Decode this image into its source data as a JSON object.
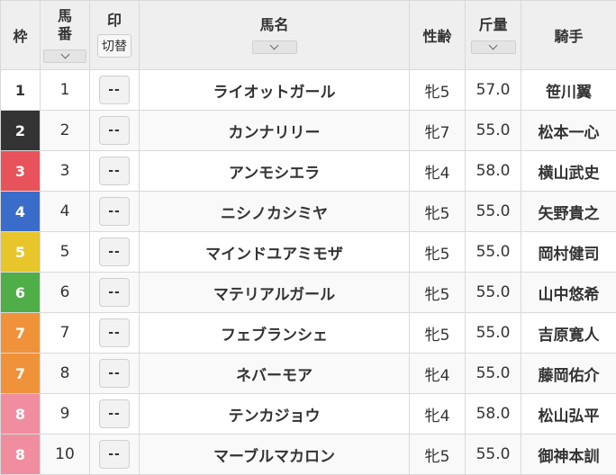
{
  "headers": {
    "waku": "枠",
    "umaban_top": "馬",
    "umaban_bottom": "番",
    "mark": "印",
    "mark_switch": "切替",
    "horse": "馬名",
    "sexage": "性齢",
    "weight": "斤量",
    "jockey": "騎手"
  },
  "frame_colors": {
    "1": {
      "bg": "#ffffff",
      "fg": "#333333"
    },
    "2": {
      "bg": "#333333",
      "fg": "#ffffff"
    },
    "3": {
      "bg": "#e8525a",
      "fg": "#ffffff"
    },
    "4": {
      "bg": "#3a6cc9",
      "fg": "#ffffff"
    },
    "5": {
      "bg": "#e8c52a",
      "fg": "#ffffff"
    },
    "6": {
      "bg": "#4fae48",
      "fg": "#ffffff"
    },
    "7": {
      "bg": "#f0923a",
      "fg": "#ffffff"
    },
    "8": {
      "bg": "#f08ea0",
      "fg": "#ffffff"
    }
  },
  "rows": [
    {
      "waku": "1",
      "umaban": "1",
      "mark": "--",
      "horse": "ライオットガール",
      "sexage": "牝5",
      "weight": "57.0",
      "jockey": "笹川翼"
    },
    {
      "waku": "2",
      "umaban": "2",
      "mark": "--",
      "horse": "カンナリリー",
      "sexage": "牝7",
      "weight": "55.0",
      "jockey": "松本一心"
    },
    {
      "waku": "3",
      "umaban": "3",
      "mark": "--",
      "horse": "アンモシエラ",
      "sexage": "牝4",
      "weight": "58.0",
      "jockey": "横山武史"
    },
    {
      "waku": "4",
      "umaban": "4",
      "mark": "--",
      "horse": "ニシノカシミヤ",
      "sexage": "牝5",
      "weight": "55.0",
      "jockey": "矢野貴之"
    },
    {
      "waku": "5",
      "umaban": "5",
      "mark": "--",
      "horse": "マインドユアミモザ",
      "sexage": "牝5",
      "weight": "55.0",
      "jockey": "岡村健司"
    },
    {
      "waku": "6",
      "umaban": "6",
      "mark": "--",
      "horse": "マテリアルガール",
      "sexage": "牝5",
      "weight": "55.0",
      "jockey": "山中悠希"
    },
    {
      "waku": "7",
      "umaban": "7",
      "mark": "--",
      "horse": "フェブランシェ",
      "sexage": "牝5",
      "weight": "55.0",
      "jockey": "吉原寛人"
    },
    {
      "waku": "7",
      "umaban": "8",
      "mark": "--",
      "horse": "ネバーモア",
      "sexage": "牝4",
      "weight": "55.0",
      "jockey": "藤岡佑介"
    },
    {
      "waku": "8",
      "umaban": "9",
      "mark": "--",
      "horse": "テンカジョウ",
      "sexage": "牝4",
      "weight": "58.0",
      "jockey": "松山弘平"
    },
    {
      "waku": "8",
      "umaban": "10",
      "mark": "--",
      "horse": "マーブルマカロン",
      "sexage": "牝5",
      "weight": "55.0",
      "jockey": "御神本訓"
    }
  ]
}
